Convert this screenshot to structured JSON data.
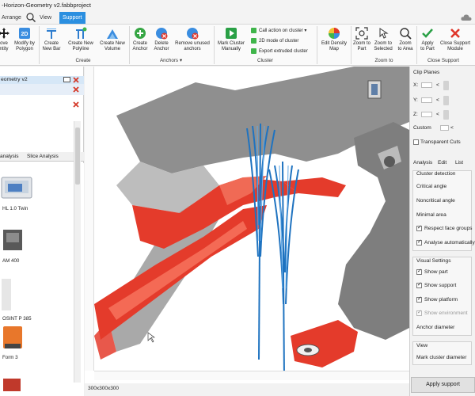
{
  "window": {
    "title": "-Horizon-Geometry v2.fabbproject"
  },
  "menu": {
    "tabs": [
      "Arrange",
      "View",
      "Support"
    ],
    "active": "Support"
  },
  "ribbon": {
    "buttons": [
      {
        "label": "ove\nntity"
      },
      {
        "label": "Modify by\nPolygon"
      },
      {
        "label": "Create\nNew Bar"
      },
      {
        "label": "Create New\nPolyline"
      },
      {
        "label": "Create New\nVolume"
      },
      {
        "label": "Create\nAnchor"
      },
      {
        "label": "Delete\nAnchor"
      },
      {
        "label": "Remove unused\nanchors"
      },
      {
        "label": "Mark Cluster\nManually"
      },
      {
        "label": "Edit Density\nMap"
      },
      {
        "label": "Zoom to\nPart"
      },
      {
        "label": "Zoom to\nSelected"
      },
      {
        "label": "Zoom\nto Area"
      },
      {
        "label": "Apply\nto Part"
      },
      {
        "label": "Close Support\nModule"
      }
    ],
    "cluster_options": [
      "Call action on cluster",
      "2D mode of cluster",
      "Export extruded cluster"
    ],
    "groups": [
      "Create",
      "Anchors",
      "Cluster",
      "Zoom to",
      "Close Support"
    ]
  },
  "left_panel": {
    "project": "eometry v2",
    "tabs": [
      "analysis",
      "Slice Analysis"
    ],
    "printers": [
      "HL 1.0 Twin",
      "AM 400",
      "OSINT P 385",
      "Form 3"
    ]
  },
  "status": {
    "build_volume": "300x300x300"
  },
  "right_panel": {
    "clip_title": "Clip Planes",
    "axes": [
      "X:",
      "Y:",
      "Z:"
    ],
    "custom": "Custom",
    "transparent_cuts": "Transparent Cuts",
    "tabs": [
      "Analysis",
      "Edit",
      "List"
    ],
    "cluster_detection": "Cluster detection",
    "critical_angle": "Critical angle",
    "noncritical_angle": "Noncritical angle",
    "minimal_area": "Minimal area",
    "respect_face_groups": "Respect face groups",
    "analyse_automatically": "Analyse automatically",
    "visual_settings": "Visual Settings",
    "show_part": "Show part",
    "show_support": "Show support",
    "show_platform": "Show platform",
    "show_environment": "Show environment",
    "anchor_diameter": "Anchor diameter",
    "view": "View",
    "mark_cluster_diameter": "Mark cluster diameter",
    "apply_support": "Apply support"
  },
  "colors": {
    "accent": "#2b8fe0",
    "part_gray": "#8f8f8f",
    "overhang_red": "#e43b2b",
    "support_blue": "#1f73c0"
  }
}
